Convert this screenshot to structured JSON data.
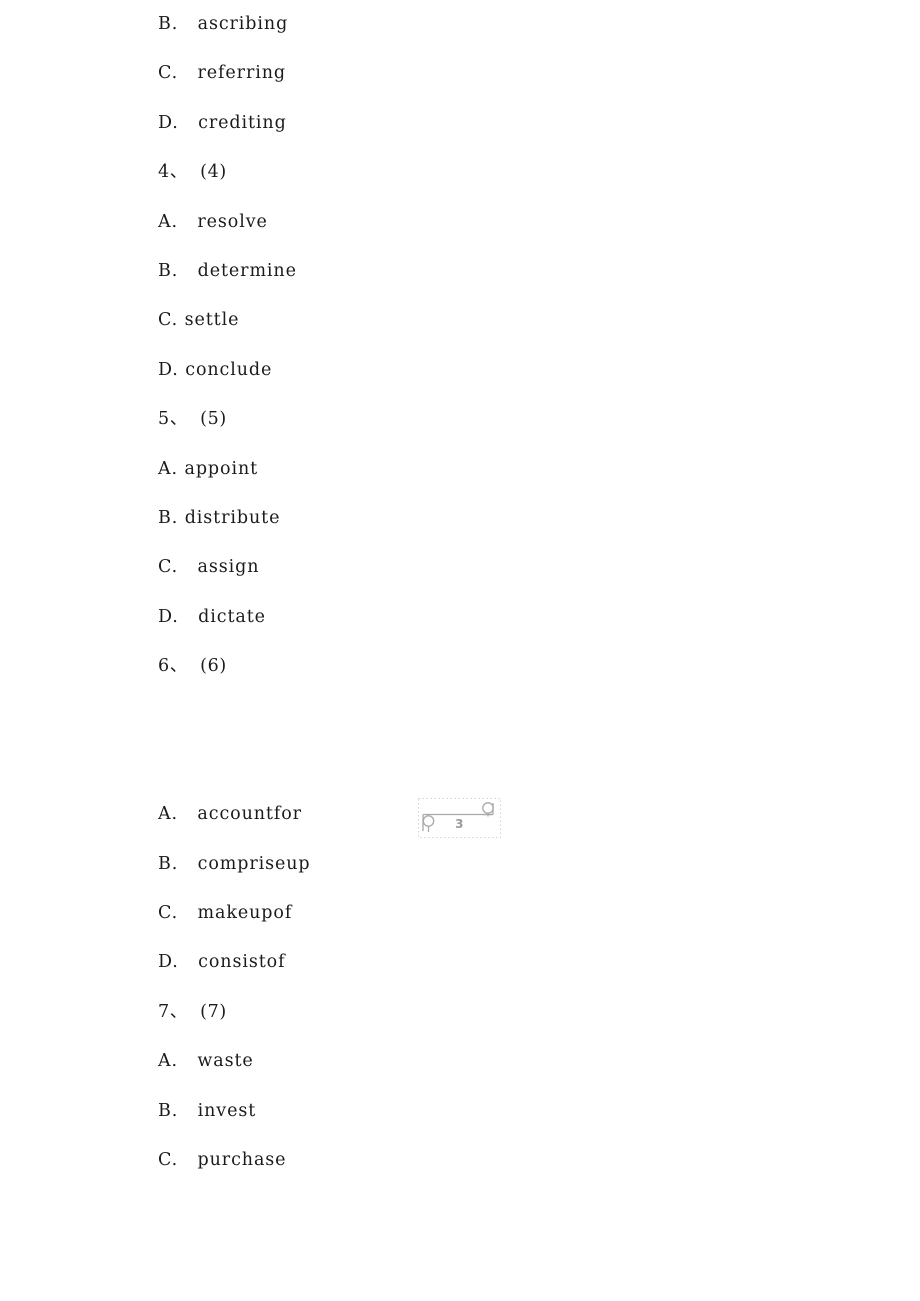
{
  "page": {
    "background_color": "#ffffff",
    "text_color": "#1b1b1b",
    "page_number": "3",
    "page_number_frame_color": "#b9b9b9"
  },
  "lines": [
    {
      "kind": "option",
      "letter": "B.",
      "spacing": "wide",
      "text": "ascribing"
    },
    {
      "kind": "option",
      "letter": "C.",
      "spacing": "wide",
      "text": "referring"
    },
    {
      "kind": "option",
      "letter": "D.",
      "spacing": "wide",
      "text": "crediting"
    },
    {
      "kind": "question",
      "number": "4",
      "mark": "、",
      "label": "(4)"
    },
    {
      "kind": "option",
      "letter": "A.",
      "spacing": "wide",
      "text": "resolve"
    },
    {
      "kind": "option",
      "letter": "B.",
      "spacing": "wide",
      "text": "determine"
    },
    {
      "kind": "option",
      "letter": "C.",
      "spacing": "tight",
      "text": "settle"
    },
    {
      "kind": "option",
      "letter": "D.",
      "spacing": "tight",
      "text": "conclude"
    },
    {
      "kind": "question",
      "number": "5",
      "mark": "、",
      "label": "(5)"
    },
    {
      "kind": "option",
      "letter": "A.",
      "spacing": "tight",
      "text": "appoint"
    },
    {
      "kind": "option",
      "letter": "B.",
      "spacing": "tight",
      "text": "distribute"
    },
    {
      "kind": "option",
      "letter": "C.",
      "spacing": "wide",
      "text": "assign"
    },
    {
      "kind": "option",
      "letter": "D.",
      "spacing": "wide",
      "text": "dictate"
    },
    {
      "kind": "question",
      "number": "6",
      "mark": "、",
      "label": "(6)"
    },
    {
      "kind": "blank"
    },
    {
      "kind": "blank"
    },
    {
      "kind": "option",
      "letter": "A.",
      "spacing": "wide",
      "text": "accountfor"
    },
    {
      "kind": "option",
      "letter": "B.",
      "spacing": "wide",
      "text": "compriseup"
    },
    {
      "kind": "option",
      "letter": "C.",
      "spacing": "wide",
      "text": "makeupof"
    },
    {
      "kind": "option",
      "letter": "D.",
      "spacing": "wide",
      "text": "consistof"
    },
    {
      "kind": "question",
      "number": "7",
      "mark": "、",
      "label": "(7)"
    },
    {
      "kind": "option",
      "letter": "A.",
      "spacing": "wide",
      "text": "waste"
    },
    {
      "kind": "option",
      "letter": "B.",
      "spacing": "wide",
      "text": "invest"
    },
    {
      "kind": "option",
      "letter": "C.",
      "spacing": "wide",
      "text": "purchase"
    }
  ]
}
